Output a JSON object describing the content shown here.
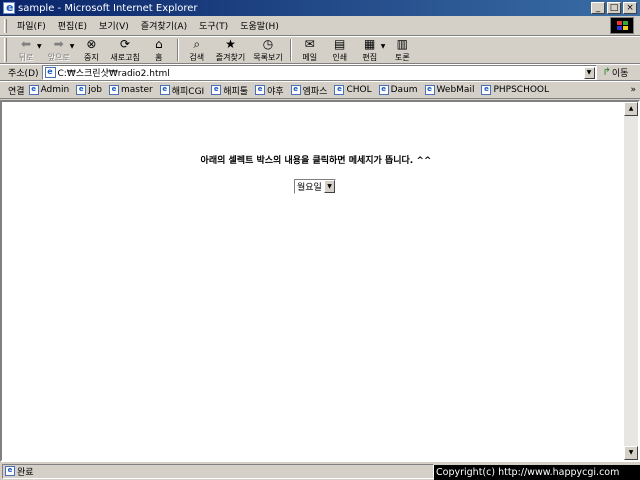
{
  "window": {
    "title": "sample - Microsoft Internet Explorer",
    "controls": [
      "_",
      "□",
      "×"
    ]
  },
  "menu": {
    "items": [
      "파일(F)",
      "편집(E)",
      "보기(V)",
      "즐겨찾기(A)",
      "도구(T)",
      "도움말(H)"
    ]
  },
  "toolbar": {
    "back": "뒤로",
    "forward": "앞으로",
    "stop": "중지",
    "refresh": "새로고침",
    "home": "홈",
    "search": "검색",
    "favorites": "즐겨찾기",
    "history": "목록보기",
    "mail": "메일",
    "print": "인쇄",
    "edit": "편집",
    "discuss": "토론"
  },
  "address": {
    "label": "주소(D)",
    "url": "C:₩스크린샷₩radio2.html",
    "go_label": "이동"
  },
  "links": {
    "label": "연결",
    "items": [
      "Admin",
      "job",
      "master",
      "해피CGI",
      "해피툴",
      "야후",
      "엠파스",
      "CHOL",
      "Daum",
      "WebMail",
      "PHPSCHOOL"
    ],
    "more": "»"
  },
  "page": {
    "message": "아래의 셀렉트 박스의 내용을 클릭하면 메세지가 뜹니다. ^^",
    "select_value": "월요일"
  },
  "status": {
    "text": "완료",
    "copyright": "Copyright(c) http://www.happycgi.com"
  },
  "colors": {
    "title_gradient_start": "#0a246a",
    "title_gradient_end": "#3a6ea5",
    "chrome": "#d4d0c8",
    "content_bg": "#ffffff"
  }
}
